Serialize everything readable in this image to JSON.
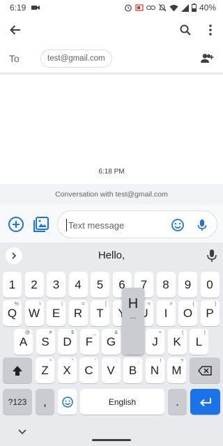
{
  "status_bar": {
    "time": "6:19",
    "battery": "40%"
  },
  "recipient": {
    "to_label": "To",
    "chip": "test@gmail.com"
  },
  "conversation": {
    "timestamp": "6:18 PM",
    "banner": "Conversation with test@gmail.com"
  },
  "compose": {
    "placeholder": "Text message",
    "value": ""
  },
  "keyboard": {
    "suggestion": "Hello,",
    "row1": [
      {
        "label": "1"
      },
      {
        "label": "2"
      },
      {
        "label": "3"
      },
      {
        "label": "4"
      },
      {
        "label": "5"
      },
      {
        "label": "6"
      },
      {
        "label": "7"
      },
      {
        "label": "8"
      },
      {
        "label": "9"
      },
      {
        "label": "0"
      }
    ],
    "row2": [
      {
        "label": "Q",
        "hint": "%"
      },
      {
        "label": "W",
        "hint": "\\"
      },
      {
        "label": "E",
        "hint": "|"
      },
      {
        "label": "R",
        "hint": "="
      },
      {
        "label": "T",
        "hint": "["
      },
      {
        "label": "Y",
        "hint": "]"
      },
      {
        "label": "U",
        "hint": "<"
      },
      {
        "label": "I",
        "hint": ">"
      },
      {
        "label": "O",
        "hint": "{"
      },
      {
        "label": "P",
        "hint": "}"
      }
    ],
    "row3": [
      {
        "label": "A",
        "hint": "@"
      },
      {
        "label": "S",
        "hint": "#"
      },
      {
        "label": "D",
        "hint": "$"
      },
      {
        "label": "F",
        "hint": "_"
      },
      {
        "label": "G",
        "hint": "&"
      },
      {
        "label": "H",
        "hint": "-"
      },
      {
        "label": "J",
        "hint": "+"
      },
      {
        "label": "K",
        "hint": "("
      },
      {
        "label": "L",
        "hint": ")"
      }
    ],
    "row4": [
      {
        "label": "Z",
        "hint": "*"
      },
      {
        "label": "X",
        "hint": "\""
      },
      {
        "label": "C",
        "hint": "'"
      },
      {
        "label": "V",
        "hint": ":"
      },
      {
        "label": "B",
        "hint": ";"
      },
      {
        "label": "N",
        "hint": "!"
      },
      {
        "label": "M",
        "hint": "?"
      }
    ],
    "symbols_label": "?123",
    "comma_label": ",",
    "space_label": "English",
    "period_label": ".",
    "popup_key": "H",
    "popup_hint": "…"
  },
  "colors": {
    "accent": "#1a73e8",
    "keyboard_bg": "#e8eaed"
  }
}
